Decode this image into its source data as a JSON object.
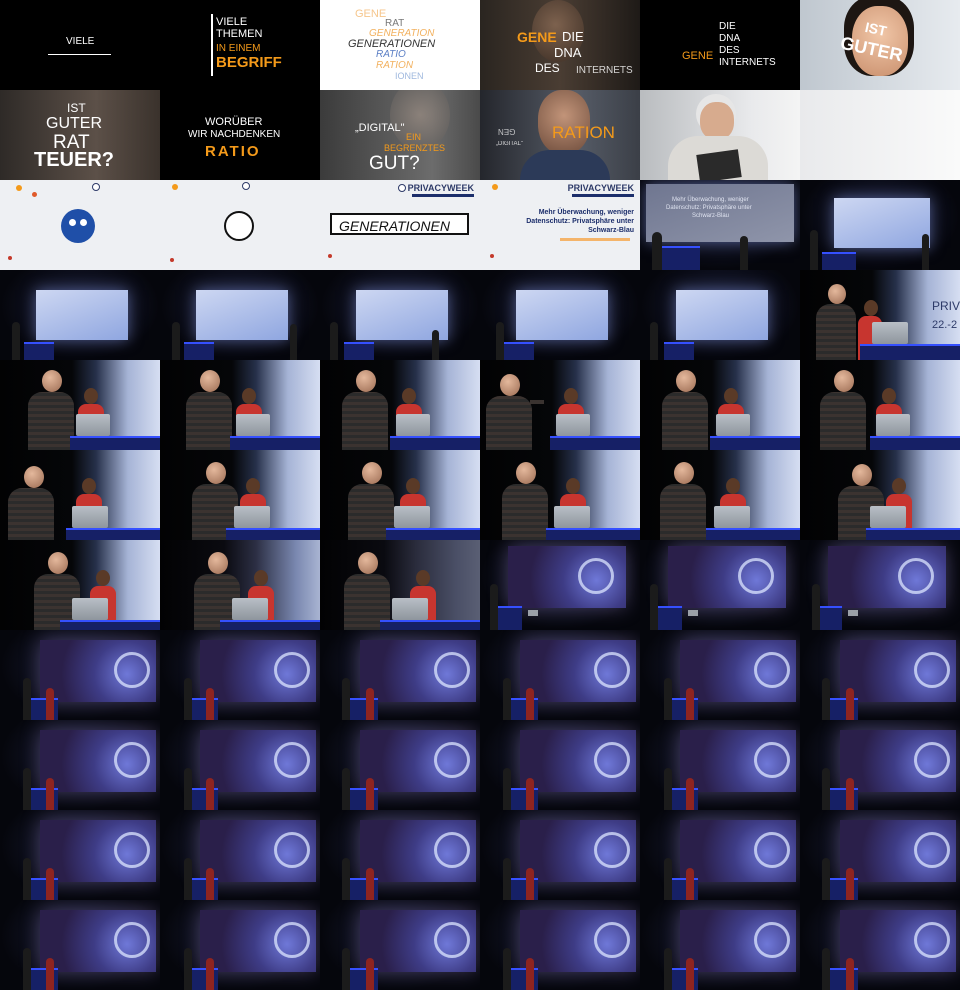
{
  "row1": {
    "c1": {
      "text": "VIELE"
    },
    "c2": {
      "l1": "VIELE",
      "l2": "THEMEN",
      "l3": "IN EINEM",
      "l4": "BEGRIFF"
    },
    "c3": {
      "w1": "GENE",
      "w2": "RAT",
      "w3": "GENERATION",
      "w4": "GENERATIONEN",
      "w5": "RATIO",
      "w6": "RATION",
      "w7": "IONEN"
    },
    "c4": {
      "w1": "GENE",
      "w2": "DIE",
      "w3": "DNA",
      "w4": "DES",
      "w5": "INTERNETS"
    },
    "c5": {
      "w1": "DIE",
      "w2": "DNA",
      "w3": "GENE",
      "w4": "DES",
      "w5": "INTERNETS"
    },
    "c6": {
      "w1": "IST",
      "w2": "GUTER"
    }
  },
  "row2": {
    "c1": {
      "w1": "IST",
      "w2": "GUTER",
      "w3": "RAT",
      "w4": "TEUER?"
    },
    "c2": {
      "l1": "WORÜBER",
      "l2": "WIR NACHDENKEN",
      "l3": "RATIO"
    },
    "c3": {
      "w1": "„DIGITAL\"",
      "w2": "EIN",
      "w3": "BEGRENZTES",
      "w4": "GUT?"
    },
    "c4": {
      "w1": "RATION",
      "w2": "„DIGITAL\"",
      "w3": "GEN"
    }
  },
  "row3": {
    "brand": "PRIVACYWEEK",
    "c3": {
      "box": "GENERATIONEN"
    },
    "c4": {
      "l1": "Mehr Überwachung, weniger",
      "l2": "Datenschutz: Privatsphäre unter",
      "l3": "Schwarz-Blau"
    },
    "c5": {
      "l1": "Mehr Überwachung, weniger",
      "l2": "Datenschutz: Privatsphäre unter",
      "l3": "Schwarz-Blau"
    },
    "c6": {
      "brand": "PRIV",
      "date": "22.-2"
    }
  },
  "close_label": "PRIV",
  "colors": {
    "accent": "#f49a1a",
    "navy": "#1c2e6b",
    "stage_blue": "#3550ff"
  }
}
